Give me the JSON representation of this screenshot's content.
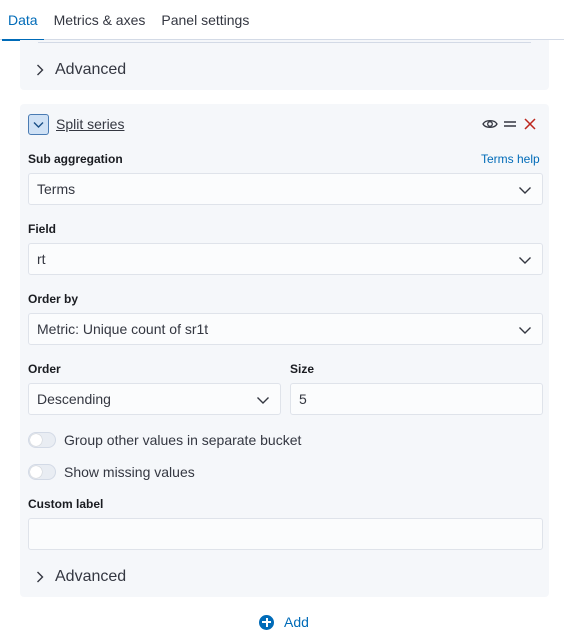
{
  "tabs": [
    {
      "label": "Data",
      "active": true
    },
    {
      "label": "Metrics & axes",
      "active": false
    },
    {
      "label": "Panel settings",
      "active": false
    }
  ],
  "advanced_label_top": "Advanced",
  "split_series": {
    "title": "Split series",
    "icons": [
      "eye-icon",
      "drag-handle-icon",
      "close-icon"
    ]
  },
  "sub_aggregation": {
    "label": "Sub aggregation",
    "help": "Terms help",
    "value": "Terms"
  },
  "field": {
    "label": "Field",
    "value": "rt"
  },
  "order_by": {
    "label": "Order by",
    "value": "Metric: Unique count of sr1t"
  },
  "order": {
    "label": "Order",
    "value": "Descending"
  },
  "size": {
    "label": "Size",
    "value": "5"
  },
  "switches": [
    {
      "label": "Group other values in separate bucket",
      "on": false
    },
    {
      "label": "Show missing values",
      "on": false
    }
  ],
  "custom_label": {
    "label": "Custom label",
    "value": ""
  },
  "advanced_label_bottom": "Advanced",
  "add_label": "Add",
  "colors": {
    "accent": "#006bb8",
    "danger": "#bd271e",
    "panel": "#f5f7fa"
  }
}
